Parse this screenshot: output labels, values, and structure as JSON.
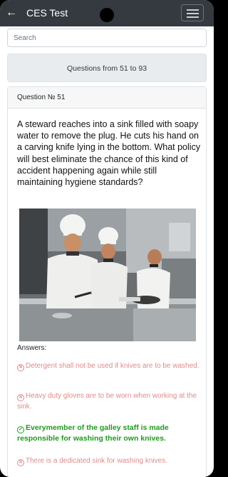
{
  "appbar": {
    "title": "CES Test",
    "back_icon": "arrow-left-icon",
    "menu_icon": "hamburger-icon"
  },
  "search": {
    "placeholder": "Search",
    "value": ""
  },
  "range_card": {
    "label": "Questions from 51 to 93"
  },
  "question": {
    "header": "Question № 51",
    "text": "A steward reaches into a sink filled with soapy water to remove the plug. He cuts his hand on a carving knife lying in the bottom. What policy will best eliminate the chance of this kind of accident happening again while still maintaining hygiene standards?",
    "answers_label": "Answers:",
    "answers": [
      {
        "text": "Detergent shall not be used if knives are to be washed.",
        "correct": false
      },
      {
        "text": "Heavy duty gloves are to be worn when working at the sink.",
        "correct": false
      },
      {
        "text": "Everymember of the galley staff is made responsible for washing their own knives.",
        "correct": true
      },
      {
        "text": "There is a dedicated sink for washing knives.",
        "correct": false
      }
    ]
  },
  "colors": {
    "appbar": "#343a40",
    "wrong": "#e08a8a",
    "correct": "#1e9a1e"
  }
}
